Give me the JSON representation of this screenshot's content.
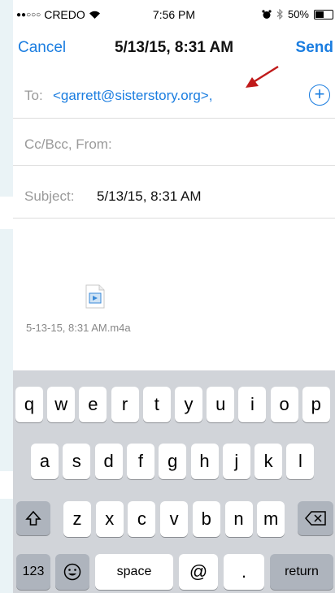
{
  "status": {
    "carrier": "CREDO",
    "time": "7:56 PM",
    "battery": "50%",
    "battery_level": 0.5
  },
  "nav": {
    "cancel": "Cancel",
    "title": "5/13/15, 8:31 AM",
    "send": "Send"
  },
  "compose": {
    "to_label": "To:",
    "to_value": "<garrett@sisterstory.org>,",
    "cc_label": "Cc/Bcc, From:",
    "subject_label": "Subject:",
    "subject_value": "5/13/15, 8:31 AM"
  },
  "attachment": {
    "filename": "5-13-15, 8:31 AM.m4a"
  },
  "keyboard": {
    "row1": [
      "q",
      "w",
      "e",
      "r",
      "t",
      "y",
      "u",
      "i",
      "o",
      "p"
    ],
    "row2": [
      "a",
      "s",
      "d",
      "f",
      "g",
      "h",
      "j",
      "k",
      "l"
    ],
    "row3": [
      "z",
      "x",
      "c",
      "v",
      "b",
      "n",
      "m"
    ],
    "numbers": "123",
    "space": "space",
    "at": "@",
    "period": ".",
    "return": "return"
  }
}
